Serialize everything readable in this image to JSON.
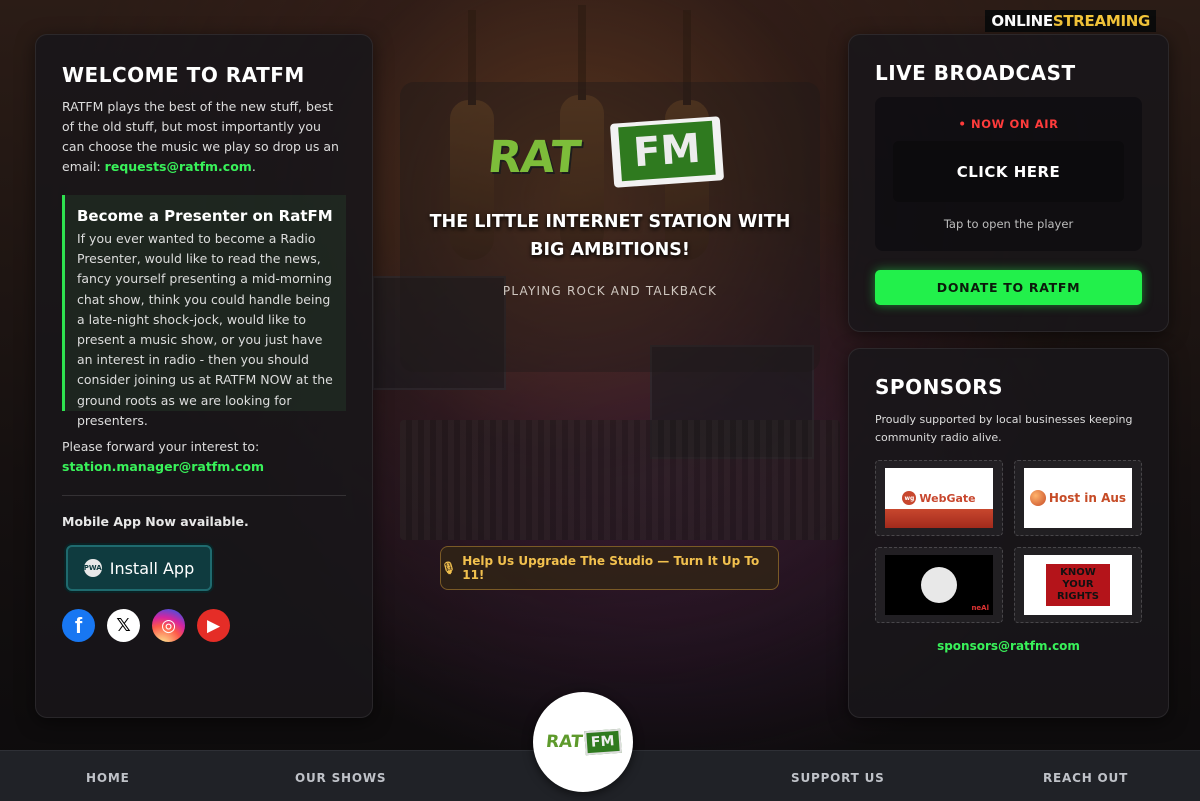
{
  "header": {
    "badge_part1": "ONLINE",
    "badge_part2": "STREAMING"
  },
  "welcome": {
    "title": "WELCOME TO RATFM",
    "intro": "RATFM plays the best of the new stuff, best of the old stuff, but most importantly you can choose the music we play so drop us an email: ",
    "request_email": "requests@ratfm.com",
    "intro_end": "."
  },
  "presenter": {
    "title": "Become a Presenter on RatFM",
    "body": "If you ever wanted to become a Radio Presenter, would like to read the news, fancy yourself presenting a mid-morning chat show, think you could handle being a late-night shock-jock, would like to present a music show, or you just have an interest in radio - then you should consider joining us at RATFM NOW at the ground roots as we are looking for presenters."
  },
  "forward": {
    "text": "Please forward your interest to:",
    "email": "station.manager@ratfm.com"
  },
  "mobile": {
    "text": "Mobile App Now available.",
    "install_label": "Install App",
    "pwa_label": "PWA"
  },
  "socials": [
    {
      "name": "facebook",
      "glyph": "f"
    },
    {
      "name": "x",
      "glyph": "𝕏"
    },
    {
      "name": "instagram",
      "glyph": "◎"
    },
    {
      "name": "youtube",
      "glyph": "▶"
    }
  ],
  "hero": {
    "logo_rat": "RAT",
    "logo_fm": "FM",
    "tagline": "THE LITTLE INTERNET STATION WITH BIG AMBITIONS!",
    "subtag": "PLAYING ROCK AND TALKBACK",
    "upgrade_icon": "🎙",
    "upgrade_label": "Help Us Upgrade The Studio — Turn It Up To 11!"
  },
  "live": {
    "title": "LIVE BROADCAST",
    "on_air": "• NOW ON AIR",
    "click_label": "CLICK HERE",
    "tap_text": "Tap to open the player",
    "donate_label": "DONATE TO RATFM"
  },
  "sponsors": {
    "title": "SPONSORS",
    "text": "Proudly supported by local businesses keeping community radio alive.",
    "webgate": "WebGate",
    "webgate_badge": "wg",
    "hostinaus": "Host in Aus",
    "neal_tag": "neAl",
    "rights": "KNOW YOUR RIGHTS",
    "email": "sponsors@ratfm.com"
  },
  "footer": {
    "nav": [
      "HOME",
      "OUR SHOWS",
      "SUPPORT US",
      "REACH OUT"
    ],
    "logo_rat": "RAT",
    "logo_fm": "FM"
  },
  "colors": {
    "accent_green": "#39f25a",
    "donate_green": "#22f04b",
    "on_air_red": "#ff3b3b",
    "upgrade_gold": "#f2c14e"
  }
}
